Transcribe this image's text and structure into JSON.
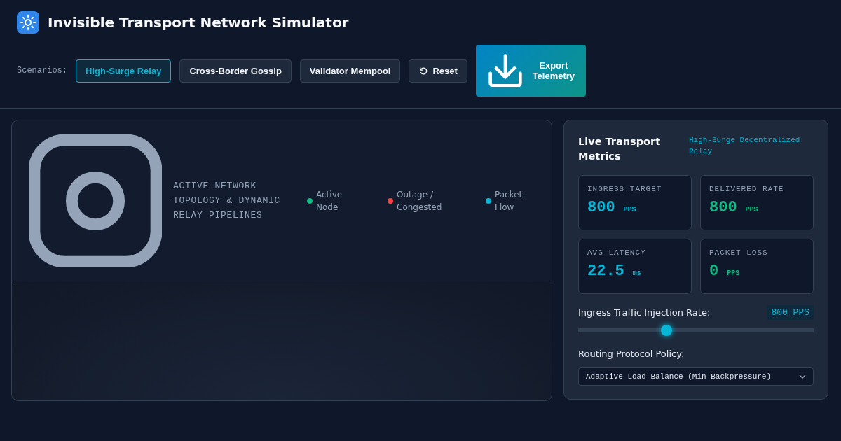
{
  "app": {
    "title": "Invisible Transport Network Simulator"
  },
  "scenarios": {
    "label": "Scenarios:",
    "buttons": [
      {
        "label": "High-Surge Relay",
        "selected": true
      },
      {
        "label": "Cross-Border Gossip",
        "selected": false
      },
      {
        "label": "Validator Mempool",
        "selected": false
      }
    ]
  },
  "reset_button": "Reset",
  "export_button": "Export Telemetry",
  "topology": {
    "heading": "ACTIVE NETWORK TOPOLOGY & DYNAMIC RELAY PIPELINES",
    "legend": [
      {
        "label": "Active Node",
        "color": "#10b981"
      },
      {
        "label": "Outage / Congested",
        "color": "#ef4444"
      },
      {
        "label": "Packet Flow",
        "color": "#06b6d4"
      }
    ]
  },
  "metrics": {
    "title": "Live Transport Metrics",
    "scenario_name": "High-Surge Decentralized Relay",
    "cards": [
      {
        "label": "INGRESS TARGET",
        "value": "800",
        "unit": "PPS",
        "color": "#06b6d4"
      },
      {
        "label": "DELIVERED RATE",
        "value": "800",
        "unit": "PPS",
        "color": "#10b981"
      },
      {
        "label": "AVG LATENCY",
        "value": "22.5",
        "unit": "ms",
        "color": "#06b6d4"
      },
      {
        "label": "PACKET LOSS",
        "value": "0",
        "unit": "PPS",
        "color": "#10b981"
      }
    ]
  },
  "injection": {
    "label": "Ingress Traffic Injection Rate:",
    "reading": "800 PPS",
    "level": 0.376
  },
  "routing": {
    "label": "Routing Protocol Policy:",
    "value": "Adaptive Load Balance (Min Backpressure)"
  }
}
